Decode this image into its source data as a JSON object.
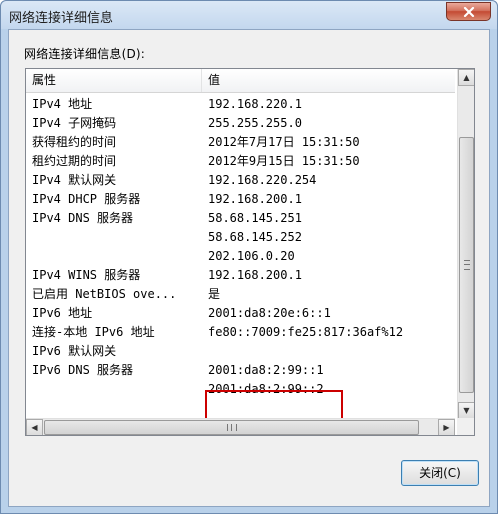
{
  "window": {
    "title": "网络连接详细信息",
    "close_icon": "close-x-icon"
  },
  "section_label": "网络连接详细信息(D):",
  "table": {
    "headers": [
      "属性",
      "值"
    ],
    "rows": [
      {
        "property": "IPv4 地址",
        "value": "192.168.220.1"
      },
      {
        "property": "IPv4 子网掩码",
        "value": "255.255.255.0"
      },
      {
        "property": "获得租约的时间",
        "value": "2012年7月17日 15:31:50"
      },
      {
        "property": "租约过期的时间",
        "value": "2012年9月15日 15:31:50"
      },
      {
        "property": "IPv4 默认网关",
        "value": "192.168.220.254"
      },
      {
        "property": "IPv4 DHCP 服务器",
        "value": "192.168.200.1"
      },
      {
        "property": "IPv4 DNS 服务器",
        "value": "58.68.145.251"
      },
      {
        "property": "",
        "value": "58.68.145.252"
      },
      {
        "property": "",
        "value": "202.106.0.20"
      },
      {
        "property": "IPv4 WINS 服务器",
        "value": "192.168.200.1"
      },
      {
        "property": "已启用 NetBIOS ove...",
        "value": "是"
      },
      {
        "property": "IPv6 地址",
        "value": "2001:da8:20e:6::1"
      },
      {
        "property": "连接-本地 IPv6 地址",
        "value": "fe80::7009:fe25:817:36af%12"
      },
      {
        "property": "IPv6 默认网关",
        "value": ""
      },
      {
        "property": "IPv6 DNS 服务器",
        "value": "2001:da8:2:99::1"
      },
      {
        "property": "",
        "value": "2001:da8:2:99::2"
      }
    ]
  },
  "close_button_label": "关闭(C)",
  "scroll_icons": {
    "up": "▲",
    "down": "▼",
    "left": "◀",
    "right": "▶"
  },
  "colors": {
    "highlight_border": "#cc0000",
    "title_bar": "#c3d7ee",
    "close_button": "#c44a33"
  }
}
